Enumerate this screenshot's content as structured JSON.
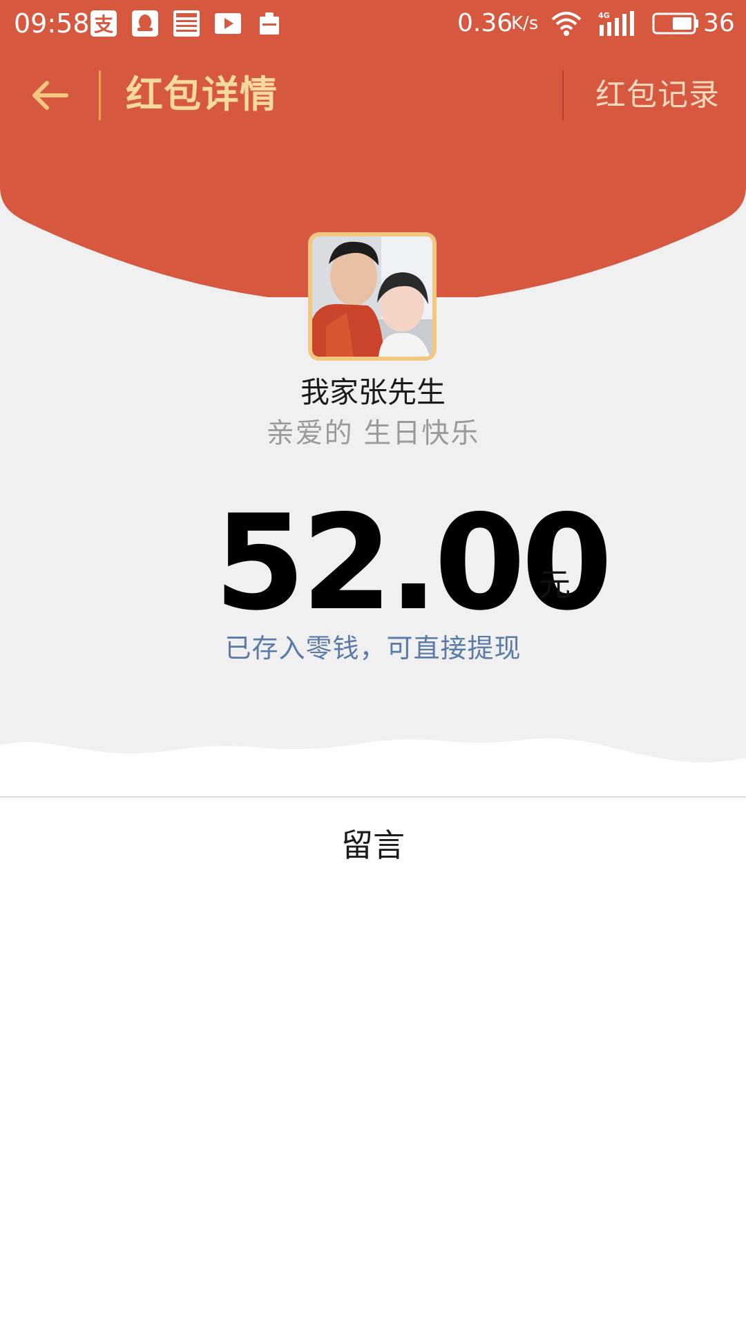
{
  "status_bar": {
    "time": "09:58",
    "speed": "0.36",
    "speed_unit": "K/s",
    "battery_level": "36",
    "icons": [
      "alipay-icon",
      "qq-icon",
      "news-icon",
      "video-play-icon",
      "clipboard-icon",
      "wifi-icon",
      "signal-4g-icon",
      "battery-icon"
    ]
  },
  "nav": {
    "title": "红包详情",
    "records_label": "红包记录"
  },
  "sender": {
    "name": "我家张先生",
    "wish": "亲爱的 生日快乐"
  },
  "amount": {
    "value": "52.00",
    "unit": "元",
    "note": "已存入零钱，可直接提现"
  },
  "message": {
    "label": "留言"
  },
  "colors": {
    "header_red": "#d6583f",
    "title_gold": "#f6d8a0",
    "note_blue": "#5a7aa8",
    "background_grey": "#f0f0f0"
  }
}
